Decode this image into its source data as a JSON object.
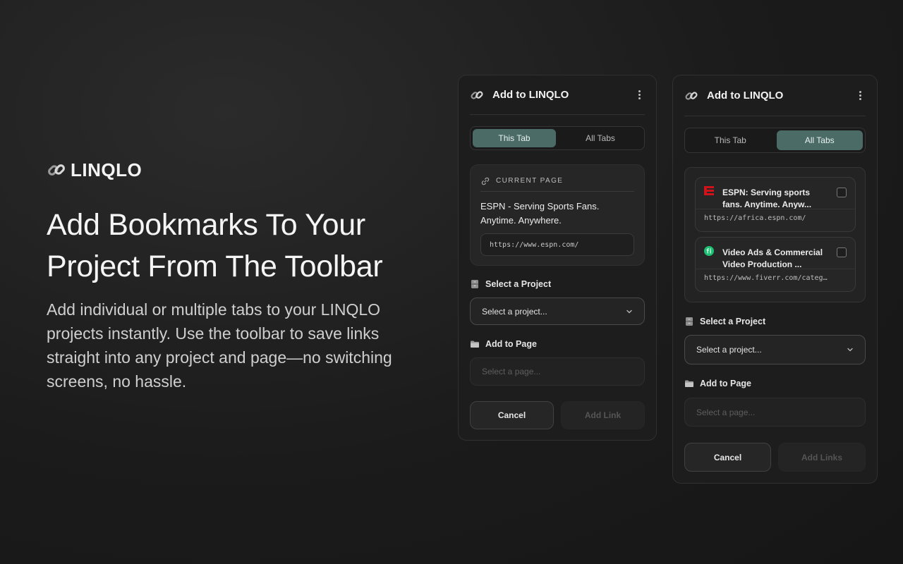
{
  "hero": {
    "brand": "LINQLO",
    "headline_line1": "Add Bookmarks To Your",
    "headline_line2": "Project From The Toolbar",
    "subcopy": "Add individual or multiple tabs to your LINQLO projects instantly. Use the toolbar to save links straight into any project and page—no switching screens, no hassle."
  },
  "panel_this_tab": {
    "title": "Add to LINQLO",
    "tabs": [
      {
        "label": "This Tab",
        "active": true
      },
      {
        "label": "All Tabs",
        "active": false
      }
    ],
    "current_page": {
      "label": "CURRENT PAGE",
      "title": "ESPN - Serving Sports Fans. Anytime. Anywhere.",
      "url": "https://www.espn.com/"
    },
    "project_label": "Select a Project",
    "project_select": "Select a project...",
    "page_label": "Add to Page",
    "page_placeholder": "Select a page...",
    "cancel": "Cancel",
    "add": "Add Link"
  },
  "panel_all_tabs": {
    "title": "Add to LINQLO",
    "tabs": [
      {
        "label": "This Tab",
        "active": false
      },
      {
        "label": "All Tabs",
        "active": true
      }
    ],
    "items": [
      {
        "title": "ESPN: Serving sports fans. Anytime. Anyw...",
        "url": "https://africa.espn.com/",
        "favicon": "espn-favicon",
        "checked": false
      },
      {
        "title": "Video Ads & Commercial Video Production ...",
        "url": "https://www.fiverr.com/categ…",
        "favicon": "fiverr-favicon",
        "checked": false
      }
    ],
    "project_label": "Select a Project",
    "project_select": "Select a project...",
    "page_label": "Add to Page",
    "page_placeholder": "Select a page...",
    "cancel": "Cancel",
    "add": "Add Links"
  },
  "colors": {
    "accent_tab": "#4a6b66",
    "espn_red": "#d0121b",
    "fiverr_green": "#1dbf73"
  }
}
